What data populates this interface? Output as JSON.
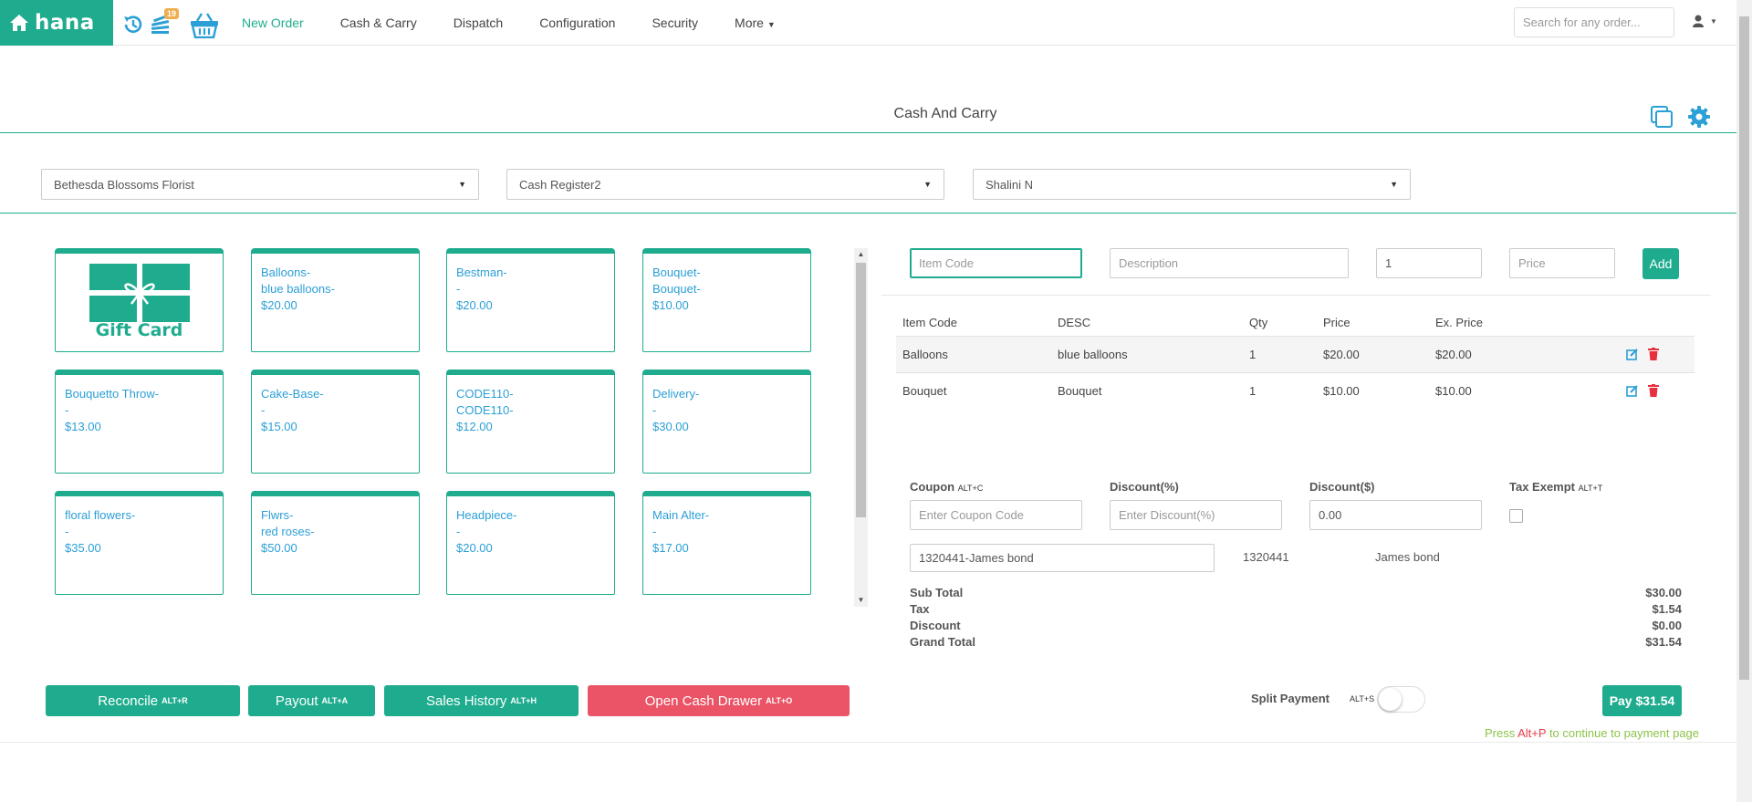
{
  "brand": {
    "name": "hana"
  },
  "nav": {
    "badge_count": "19",
    "links": [
      "New Order",
      "Cash & Carry",
      "Dispatch",
      "Configuration",
      "Security",
      "More"
    ],
    "search_placeholder": "Search for any order..."
  },
  "page": {
    "title": "Cash And Carry"
  },
  "selectors": {
    "store": "Bethesda Blossoms Florist",
    "register": "Cash Register2",
    "employee": "Shalini N"
  },
  "products": {
    "gift_card_label": "Gift Card",
    "tiles": [
      [
        "Balloons-",
        "blue balloons-",
        "$20.00"
      ],
      [
        "Bestman-",
        "-",
        "$20.00"
      ],
      [
        "Bouquet-",
        "Bouquet-",
        "$10.00"
      ],
      [
        "Bouquetto Throw-",
        "-",
        "$13.00"
      ],
      [
        "Cake-Base-",
        "-",
        "$15.00"
      ],
      [
        "CODE110-",
        "CODE110-",
        "$12.00"
      ],
      [
        "Delivery-",
        "-",
        "$30.00"
      ],
      [
        "floral flowers-",
        "-",
        "$35.00"
      ],
      [
        "Flwrs-",
        "red roses-",
        "$50.00"
      ],
      [
        "Headpiece-",
        "-",
        "$20.00"
      ],
      [
        "Main Alter-",
        "-",
        "$17.00"
      ]
    ]
  },
  "entry": {
    "item_code_placeholder": "Item Code",
    "description_placeholder": "Description",
    "qty_value": "1",
    "price_placeholder": "Price",
    "add_label": "Add"
  },
  "order_table": {
    "headers": [
      "Item Code",
      "DESC",
      "Qty",
      "Price",
      "Ex. Price"
    ],
    "rows": [
      [
        "Balloons",
        "blue balloons",
        "1",
        "$20.00",
        "$20.00"
      ],
      [
        "Bouquet",
        "Bouquet",
        "1",
        "$10.00",
        "$10.00"
      ]
    ]
  },
  "discounts": {
    "coupon_label": "Coupon",
    "coupon_key": "ALT+C",
    "coupon_placeholder": "Enter Coupon Code",
    "discount_pct_label": "Discount(%)",
    "discount_pct_placeholder": "Enter Discount(%)",
    "discount_amt_label": "Discount($)",
    "discount_amt_value": "0.00",
    "tax_exempt_label": "Tax Exempt",
    "tax_exempt_key": "ALT+T"
  },
  "customer": {
    "field_value": "1320441-James  bond",
    "id": "1320441",
    "name": "James bond"
  },
  "totals": [
    [
      "Sub Total",
      "$30.00"
    ],
    [
      "Tax",
      "$1.54"
    ],
    [
      "Discount",
      "$0.00"
    ],
    [
      "Grand Total",
      "$31.54"
    ]
  ],
  "actions": {
    "reconcile": "Reconcile",
    "reconcile_key": "ALT+R",
    "payout": "Payout",
    "payout_key": "ALT+A",
    "sales_history": "Sales History",
    "sales_history_key": "ALT+H",
    "open_drawer": "Open Cash Drawer",
    "open_drawer_key": "ALT+O",
    "split_payment": "Split Payment",
    "split_payment_key": "ALT+S",
    "pay": "Pay $31.54",
    "hint_pre": "Press ",
    "hint_key": "Alt+P",
    "hint_post": " to continue to payment page"
  },
  "colors": {
    "accent": "#1fac8e",
    "link": "#2b9fd6",
    "danger": "#ea5466",
    "hint": "#8dc34a"
  }
}
